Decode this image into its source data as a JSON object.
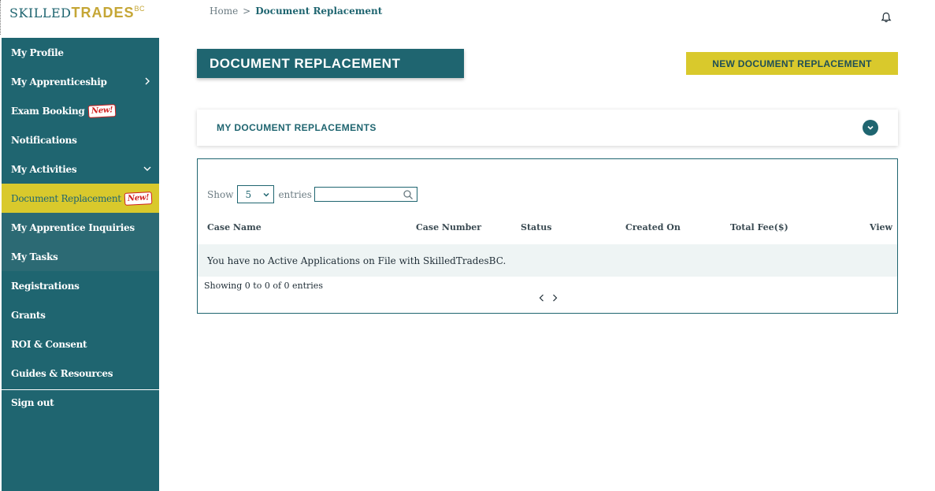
{
  "logo": {
    "part1": "SKILLED",
    "part2": "TRADES",
    "part3": "BC"
  },
  "breadcrumb": {
    "home": "Home",
    "separator": ">",
    "current": "Document Replacement"
  },
  "sidebar": {
    "items": [
      {
        "label": "My Profile"
      },
      {
        "label": "My Apprenticeship"
      },
      {
        "label": "Exam Booking",
        "badge": "New!"
      },
      {
        "label": "Notifications"
      },
      {
        "label": "My Activities"
      },
      {
        "label": "Document Replacement",
        "badge": "New!"
      },
      {
        "label": "My Apprentice Inquiries"
      },
      {
        "label": "My Tasks"
      },
      {
        "label": "Registrations"
      },
      {
        "label": "Grants"
      },
      {
        "label": "ROI & Consent"
      },
      {
        "label": "Guides & Resources"
      },
      {
        "label": "Sign out"
      }
    ]
  },
  "page": {
    "title": "DOCUMENT REPLACEMENT",
    "new_button": "NEW DOCUMENT REPLACEMENT",
    "accordion_label": "MY DOCUMENT REPLACEMENTS"
  },
  "table": {
    "show_label": "Show",
    "entries_value": "5",
    "entries_label": "entries",
    "search_value": "",
    "columns": [
      "Case Name",
      "Case Number",
      "Status",
      "Created On",
      "Total Fee($)",
      "View"
    ],
    "empty_message": "You have no Active Applications on File with SkilledTradesBC.",
    "info": "Showing 0 to 0 of 0 entries"
  },
  "colors": {
    "primary": "#1f6570",
    "accent": "#d9c92c",
    "badge": "#d02020"
  },
  "icons": [
    "bell-icon",
    "chevron-right-icon",
    "chevron-down-icon",
    "search-icon",
    "prev-page-icon",
    "next-page-icon"
  ]
}
